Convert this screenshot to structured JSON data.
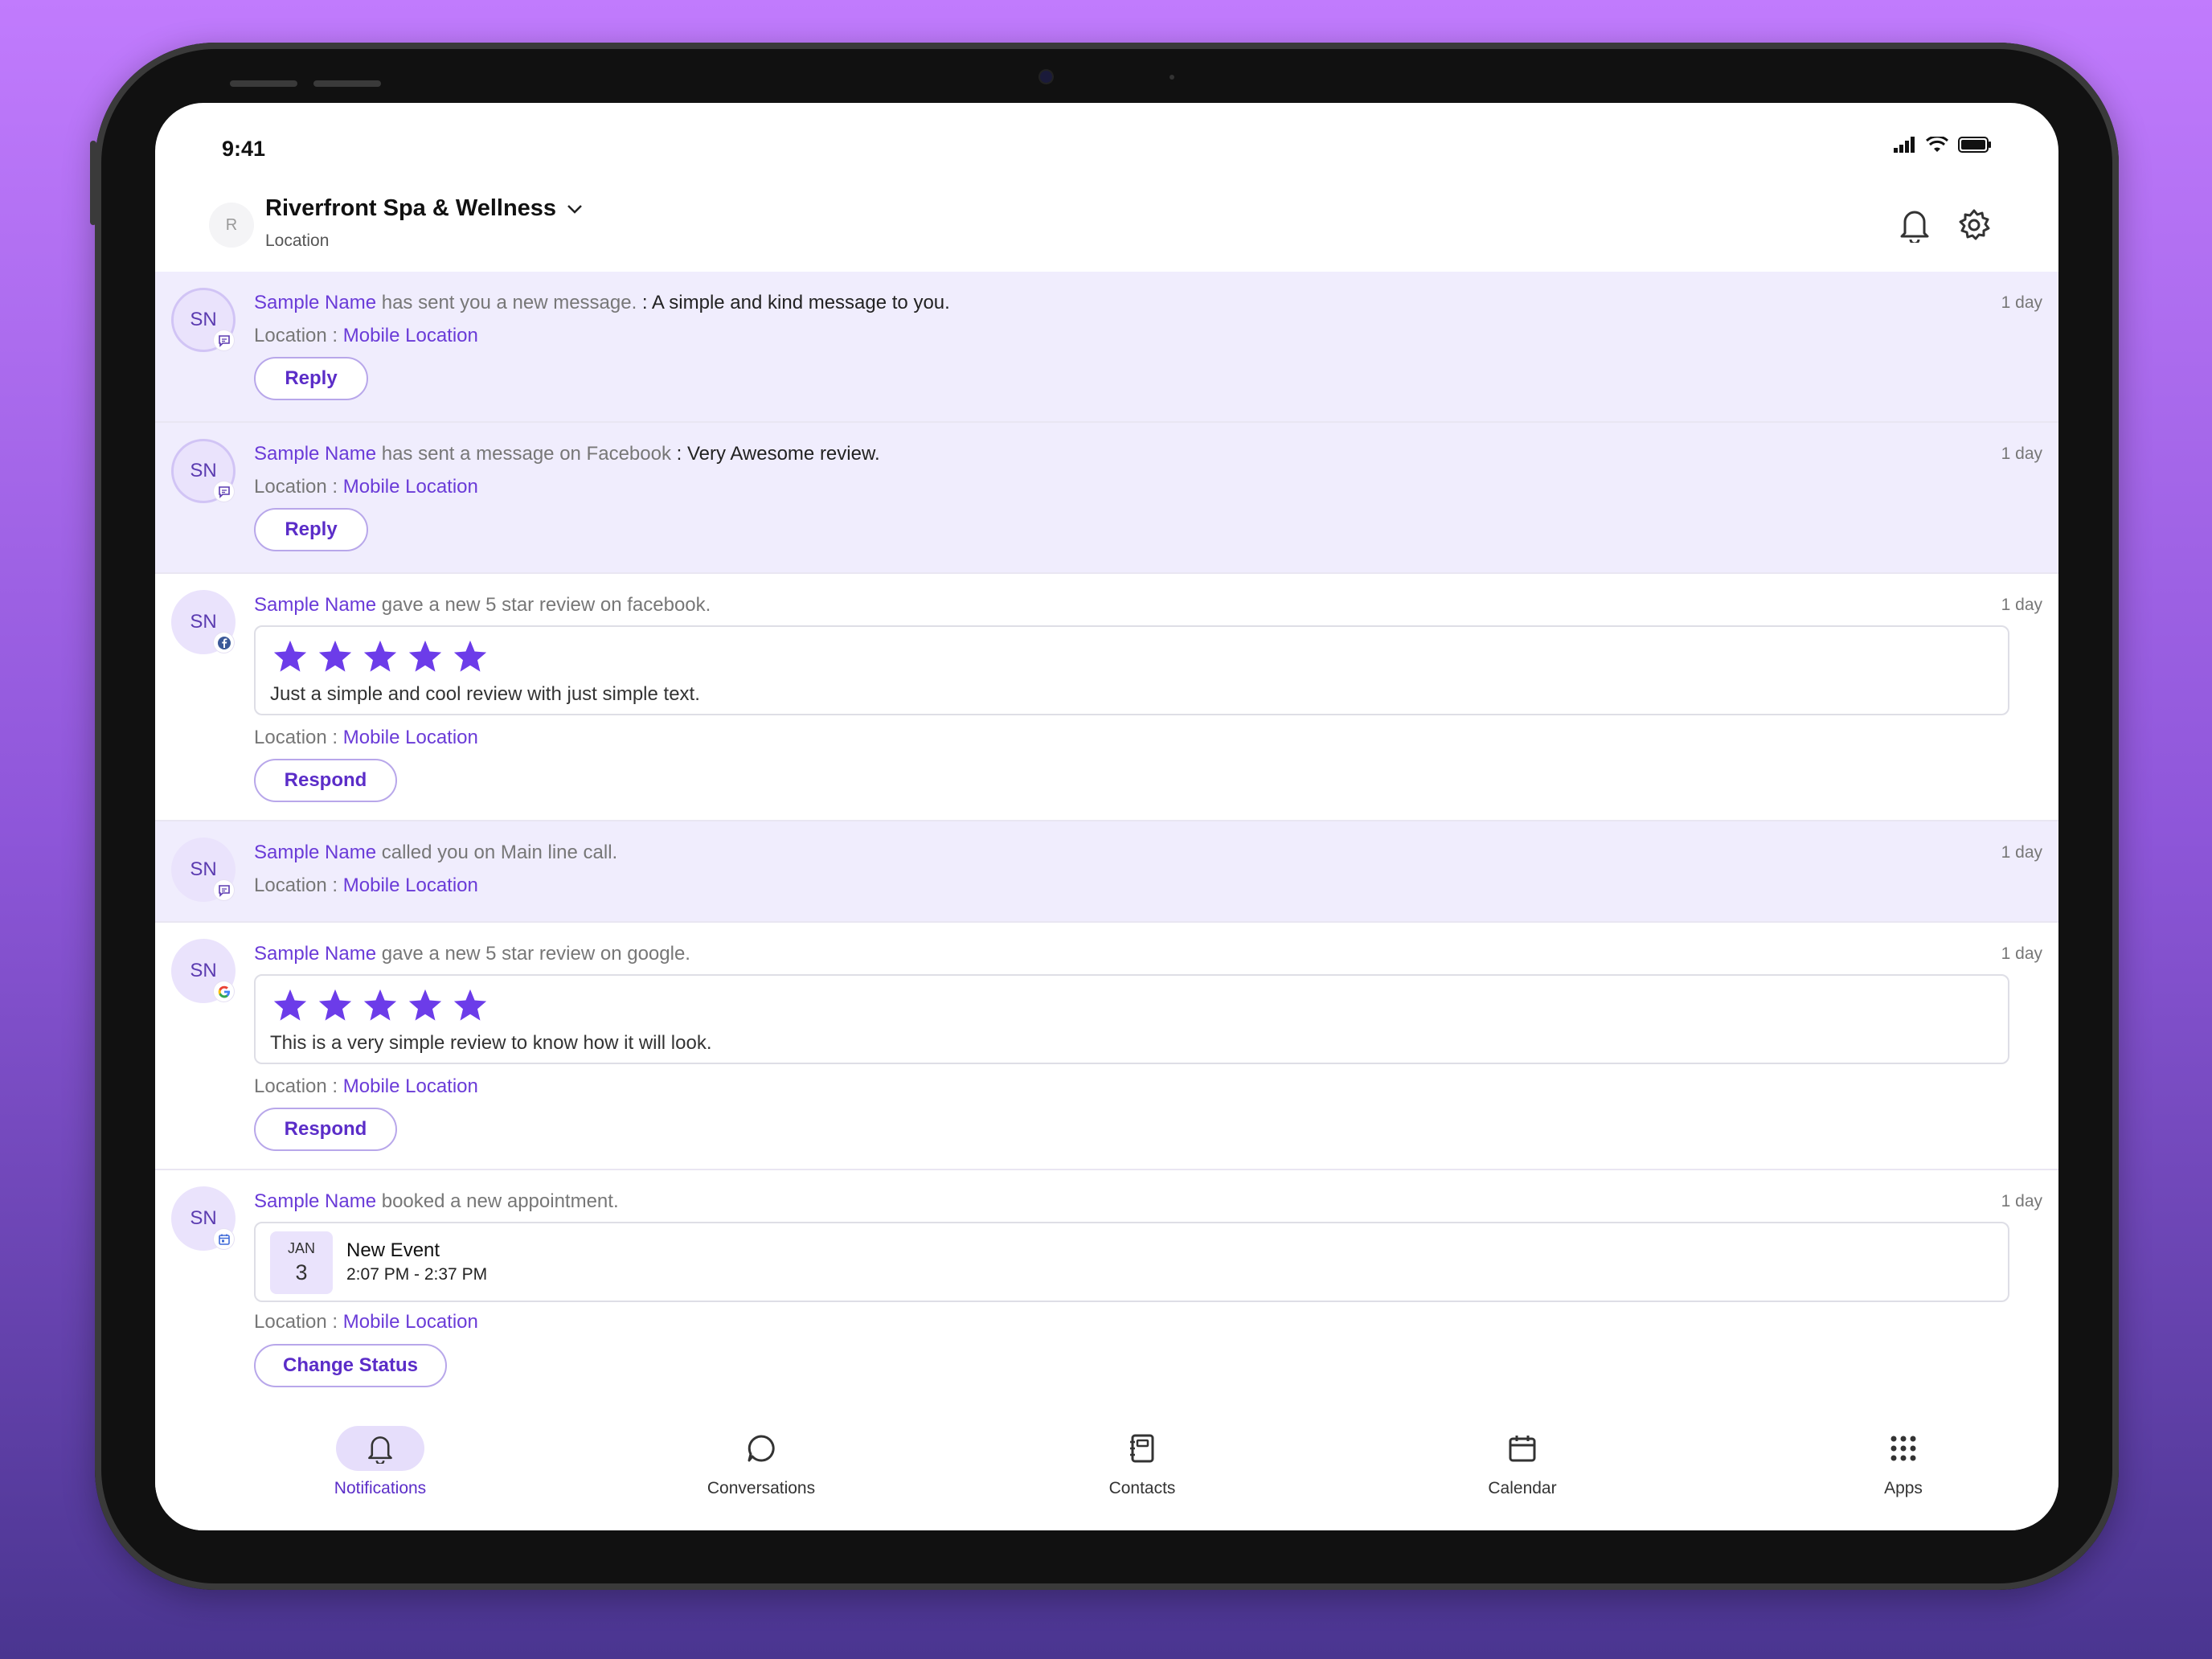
{
  "status_bar": {
    "time": "9:41"
  },
  "header": {
    "avatar_initial": "R",
    "location_name": "Riverfront Spa & Wellness",
    "location_sub": "Location"
  },
  "notifications": [
    {
      "initials": "SN",
      "name": "Sample Name",
      "action": " has sent you a new message. ",
      "message": ": A simple and kind message to you.",
      "ago": "1 day",
      "location_label": "Location : ",
      "location_value": "Mobile Location",
      "button": "Reply",
      "badge": "chat-icon"
    },
    {
      "initials": "SN",
      "name": "Sample Name",
      "action": " has sent a message on Facebook ",
      "message": ": Very Awesome review.",
      "ago": "1 day",
      "location_label": "Location : ",
      "location_value": "Mobile Location",
      "button": "Reply",
      "badge": "chat-icon"
    },
    {
      "initials": "SN",
      "name": "Sample Name",
      "action": " gave a new 5 star review on facebook.",
      "ago": "1 day",
      "rating": 5,
      "review": "Just a simple and cool review with just simple text.",
      "location_label": "Location : ",
      "location_value": "Mobile Location",
      "button": "Respond",
      "badge": "facebook-icon"
    },
    {
      "initials": "SN",
      "name": "Sample Name",
      "action": " called you on Main line call.",
      "ago": "1 day",
      "location_label": "Location : ",
      "location_value": "Mobile Location",
      "badge": "chat-icon"
    },
    {
      "initials": "SN",
      "name": "Sample Name",
      "action": " gave a new 5 star review on google.",
      "ago": "1 day",
      "rating": 5,
      "review": "This is a very simple review to know how it will look.",
      "location_label": "Location : ",
      "location_value": "Mobile Location",
      "button": "Respond",
      "badge": "google-icon"
    },
    {
      "initials": "SN",
      "name": "Sample Name",
      "action": " booked a new appointment.",
      "ago": "1 day",
      "event": {
        "month": "JAN",
        "day": "3",
        "title": "New Event",
        "time": "2:07 PM - 2:37 PM"
      },
      "location_label": "Location : ",
      "location_value": "Mobile Location",
      "button": "Change Status",
      "badge": "calendar-icon"
    }
  ],
  "tabs": [
    {
      "label": "Notifications",
      "icon": "bell-icon"
    },
    {
      "label": "Conversations",
      "icon": "chat-bubble-icon"
    },
    {
      "label": "Contacts",
      "icon": "contacts-book-icon"
    },
    {
      "label": "Calendar",
      "icon": "calendar-icon"
    },
    {
      "label": "Apps",
      "icon": "apps-grid-icon"
    }
  ],
  "colors": {
    "accent": "#6A3BD8",
    "unread_bg": "#F0EDFD",
    "star": "#6C3CE9"
  }
}
